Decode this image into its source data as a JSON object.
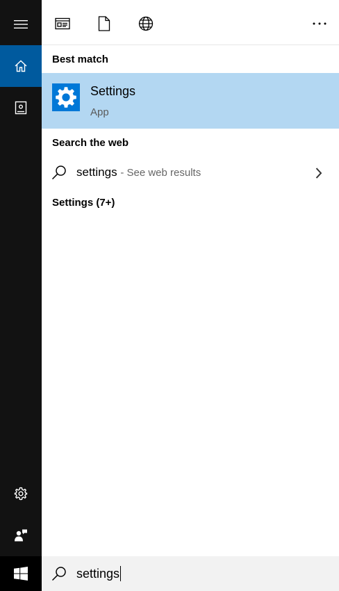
{
  "rail": {
    "items": [
      {
        "icon": "hamburger-menu-icon"
      },
      {
        "icon": "home-icon",
        "active": true
      },
      {
        "icon": "notebook-icon"
      },
      {
        "icon": "gear-icon"
      },
      {
        "icon": "feedback-icon"
      }
    ],
    "start_icon": "windows-logo-icon"
  },
  "toolbar": {
    "filters": [
      {
        "icon": "apps-filter-icon"
      },
      {
        "icon": "documents-filter-icon"
      },
      {
        "icon": "web-filter-icon"
      }
    ],
    "more_icon": "more-icon"
  },
  "results": {
    "best_match_header": "Best match",
    "best_match": {
      "name": "Settings",
      "type": "App",
      "icon": "settings-gear-icon"
    },
    "web_header": "Search the web",
    "web_result": {
      "query": "settings",
      "hint": "- See web results"
    },
    "more_header": "Settings (7+)"
  },
  "search": {
    "value": "settings"
  },
  "colors": {
    "rail_bg": "#121212",
    "active_accent": "#005a9e",
    "highlight": "#b3d7f2",
    "tile": "#0078d7",
    "search_bg": "#f2f2f2"
  }
}
